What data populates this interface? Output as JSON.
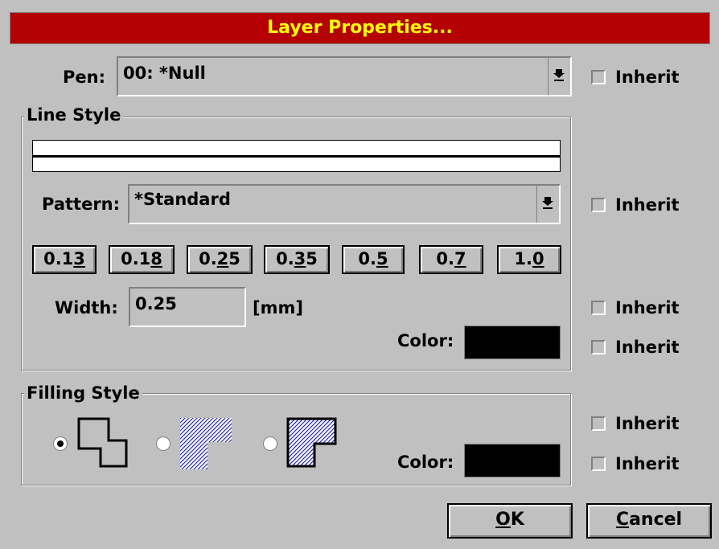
{
  "window": {
    "title": "Layer Properties..."
  },
  "pen": {
    "label": "Pen:",
    "value": "00: *Null",
    "inherit_label": "Inherit"
  },
  "line_style": {
    "group_label": "Line Style",
    "pattern_label": "Pattern:",
    "pattern_value": "*Standard",
    "pattern_inherit_label": "Inherit",
    "width_buttons": [
      {
        "pre": "0.1",
        "ul": "3",
        "post": ""
      },
      {
        "pre": "0.1",
        "ul": "8",
        "post": ""
      },
      {
        "pre": "0.",
        "ul": "2",
        "post": "5"
      },
      {
        "pre": "0.",
        "ul": "3",
        "post": "5"
      },
      {
        "pre": "0.",
        "ul": "5",
        "post": ""
      },
      {
        "pre": "0.",
        "ul": "7",
        "post": ""
      },
      {
        "pre": "1.",
        "ul": "0",
        "post": ""
      }
    ],
    "width_label": "Width:",
    "width_value": "0.25",
    "width_unit": "[mm]",
    "width_inherit_label": "Inherit",
    "color_label": "Color:",
    "color_value": "#000000",
    "color_inherit_label": "Inherit"
  },
  "filling_style": {
    "group_label": "Filling Style",
    "options": [
      "outline",
      "hatched",
      "hatched-outline"
    ],
    "selected_index": 0,
    "inherit_label": "Inherit",
    "color_label": "Color:",
    "color_value": "#000000",
    "color_inherit_label": "Inherit"
  },
  "buttons": {
    "ok": {
      "ul": "O",
      "rest": "K"
    },
    "cancel": {
      "ul": "C",
      "rest": "ancel"
    }
  }
}
